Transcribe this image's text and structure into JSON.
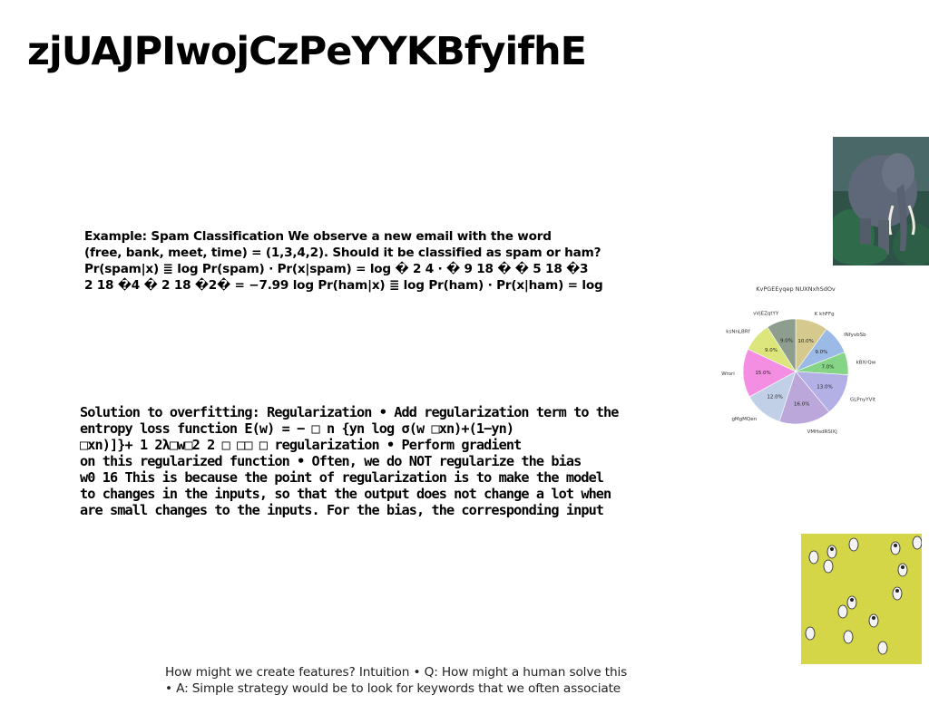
{
  "slide": {
    "title": "zjUAJPIwojCzPeYYKBfyifhE"
  },
  "block1": {
    "lines": [
      "Example: Spam Classification We observe a new email with the word",
      "(free, bank, meet, time) = (1,3,4,2). Should it be classified as spam or ham?",
      "Pr(spam|x) ≣ log Pr(spam) ⋅ Pr(x|spam) = log � 2 4 ⋅ � 9 18 � � 5 18 �3",
      "2 18 �4 � 2 18 �2� = −7.99 log Pr(ham|x) ≣ log Pr(ham) ⋅ Pr(x|ham) = log"
    ]
  },
  "block2": {
    "lines": [
      "Solution to overfitting: Regularization • Add regularization term to the",
      "entropy loss function E(w) = − □ n {yn log σ(w □xn)+(1−yn)",
      "□xn)]}+ 1 2λ□w□2 2 □ □□ □ regularization • Perform gradient",
      "on this regularized function • Often, we do NOT regularize the bias",
      "w0 16 This is because the point of regularization is to make the model",
      "to changes in the inputs, so that the output does not change a lot when",
      "are small changes to the inputs. For the bias, the corresponding input"
    ]
  },
  "block3": {
    "lines": [
      "How might we create features? Intuition • Q: How might a human solve this",
      "• A: Simple strategy would be to look for keywords that we often associate"
    ]
  },
  "images": {
    "elephant": "elephant-photo",
    "figures": "white-figures-on-yellow-photo"
  },
  "chart_data": {
    "type": "pie",
    "title": "",
    "labels": [
      "K khFFg",
      "iNfyvbSb",
      "kBXrQwxl",
      "GLPnyYVlt",
      "VMHsdRSlXj",
      "gMgMQen",
      "uWrori",
      "ksNnLBRf",
      "vVjEZqtYY"
    ],
    "values": [
      10.0,
      9.0,
      7.0,
      13.0,
      16.0,
      12.0,
      15.0,
      9.0,
      9.0
    ],
    "pct_labels": [
      "10.0%",
      "9.0%",
      "7.0%",
      "13.0%",
      "16.0%",
      "12.0%",
      "15.0%",
      "9.0%",
      "9.0%"
    ],
    "colors": [
      "#d6c98e",
      "#9bbbe6",
      "#86d486",
      "#b3b0e6",
      "#bba7d9",
      "#c1d0e6",
      "#f48ee2",
      "#dce67c",
      "#8e9e8e"
    ],
    "extra_label": "KvPGEEyqep NUXNxhSdOv",
    "start_angle_deg": 90,
    "direction": "clockwise"
  }
}
